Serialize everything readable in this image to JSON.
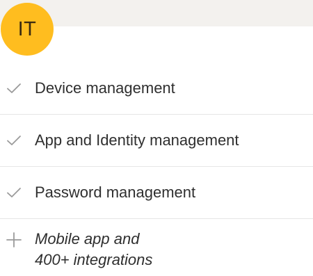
{
  "badge": {
    "text": "IT",
    "color": "#ffbd1f"
  },
  "features": [
    {
      "label": "Device management",
      "icon": "check-icon"
    },
    {
      "label": "App and Identity management",
      "icon": "check-icon"
    },
    {
      "label": "Password management",
      "icon": "check-icon"
    }
  ],
  "extra": {
    "line1": "Mobile app and",
    "line2": "400+ integrations",
    "icon": "plus-icon"
  }
}
